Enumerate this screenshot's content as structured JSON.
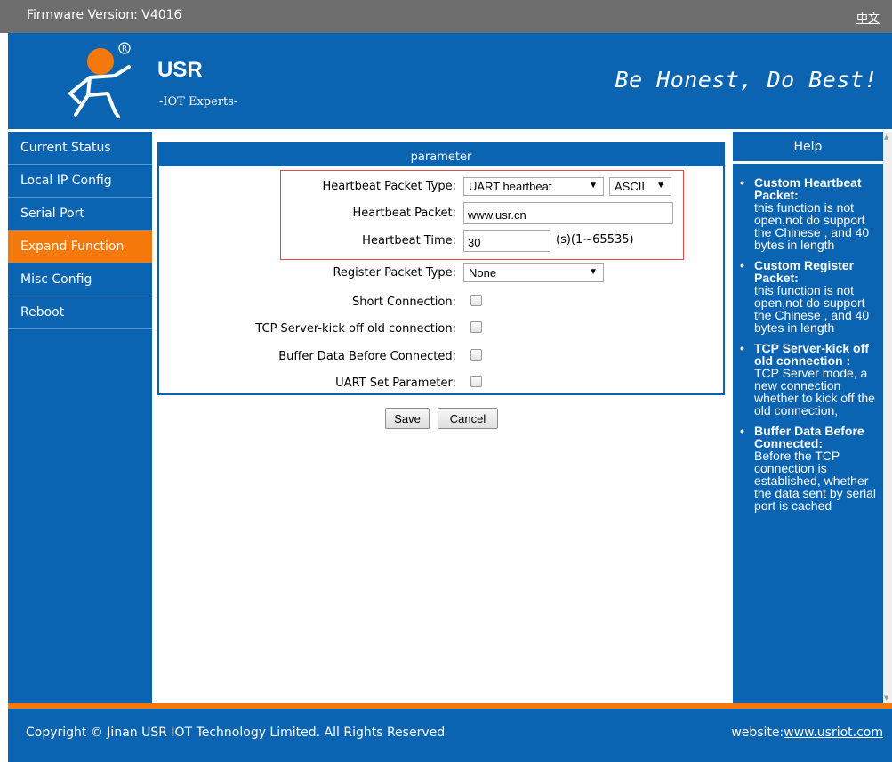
{
  "topbar": {
    "firmware": "Firmware Version: V4016",
    "language": "中文"
  },
  "header": {
    "brand": "USR",
    "brand_sub": "-IOT Experts-",
    "slogan": "Be Honest, Do Best!"
  },
  "sidebar": {
    "items": [
      {
        "label": "Current Status"
      },
      {
        "label": "Local IP Config"
      },
      {
        "label": "Serial Port"
      },
      {
        "label": "Expand Function",
        "active": true
      },
      {
        "label": "Misc Config"
      },
      {
        "label": "Reboot"
      }
    ]
  },
  "panel": {
    "title": "parameter",
    "heartbeat_type_label": "Heartbeat Packet Type:",
    "heartbeat_type_value": "UART heartbeat",
    "heartbeat_format_value": "ASCII",
    "heartbeat_packet_label": "Heartbeat Packet:",
    "heartbeat_packet_value": "www.usr.cn",
    "heartbeat_time_label": "Heartbeat Time:",
    "heartbeat_time_value": "30",
    "heartbeat_time_unit": "(s)(1~65535)",
    "register_type_label": "Register Packet Type:",
    "register_type_value": "None",
    "short_conn_label": "Short Connection:",
    "kick_label": "TCP Server-kick off old connection:",
    "buffer_label": "Buffer Data Before Connected:",
    "uart_set_label": "UART Set Parameter:"
  },
  "buttons": {
    "save": "Save",
    "cancel": "Cancel"
  },
  "help": {
    "title": "Help",
    "items": [
      {
        "title": "Custom Heartbeat Packet:",
        "text": "this function is not open,not do support the Chinese , and 40 bytes in length"
      },
      {
        "title": "Custom Register Packet:",
        "text": "this function is not open,not do support the Chinese , and 40 bytes in length"
      },
      {
        "title": "TCP Server-kick off old connection :",
        "text": "TCP Server mode, a new connection whether to kick off the old connection,"
      },
      {
        "title": "Buffer Data Before Connected:",
        "text": "Before the TCP connection is established, whether the data sent by serial port is cached"
      }
    ]
  },
  "footer": {
    "copyright": "Copyright © Jinan USR IOT Technology Limited. All Rights Reserved",
    "website_label": "website:",
    "website_url": "www.usriot.com"
  },
  "colors": {
    "brand_blue": "#0a64b2",
    "accent_orange": "#f5780a",
    "highlight_red": "#e14a4a",
    "topbar_gray": "#6e6e6e"
  }
}
